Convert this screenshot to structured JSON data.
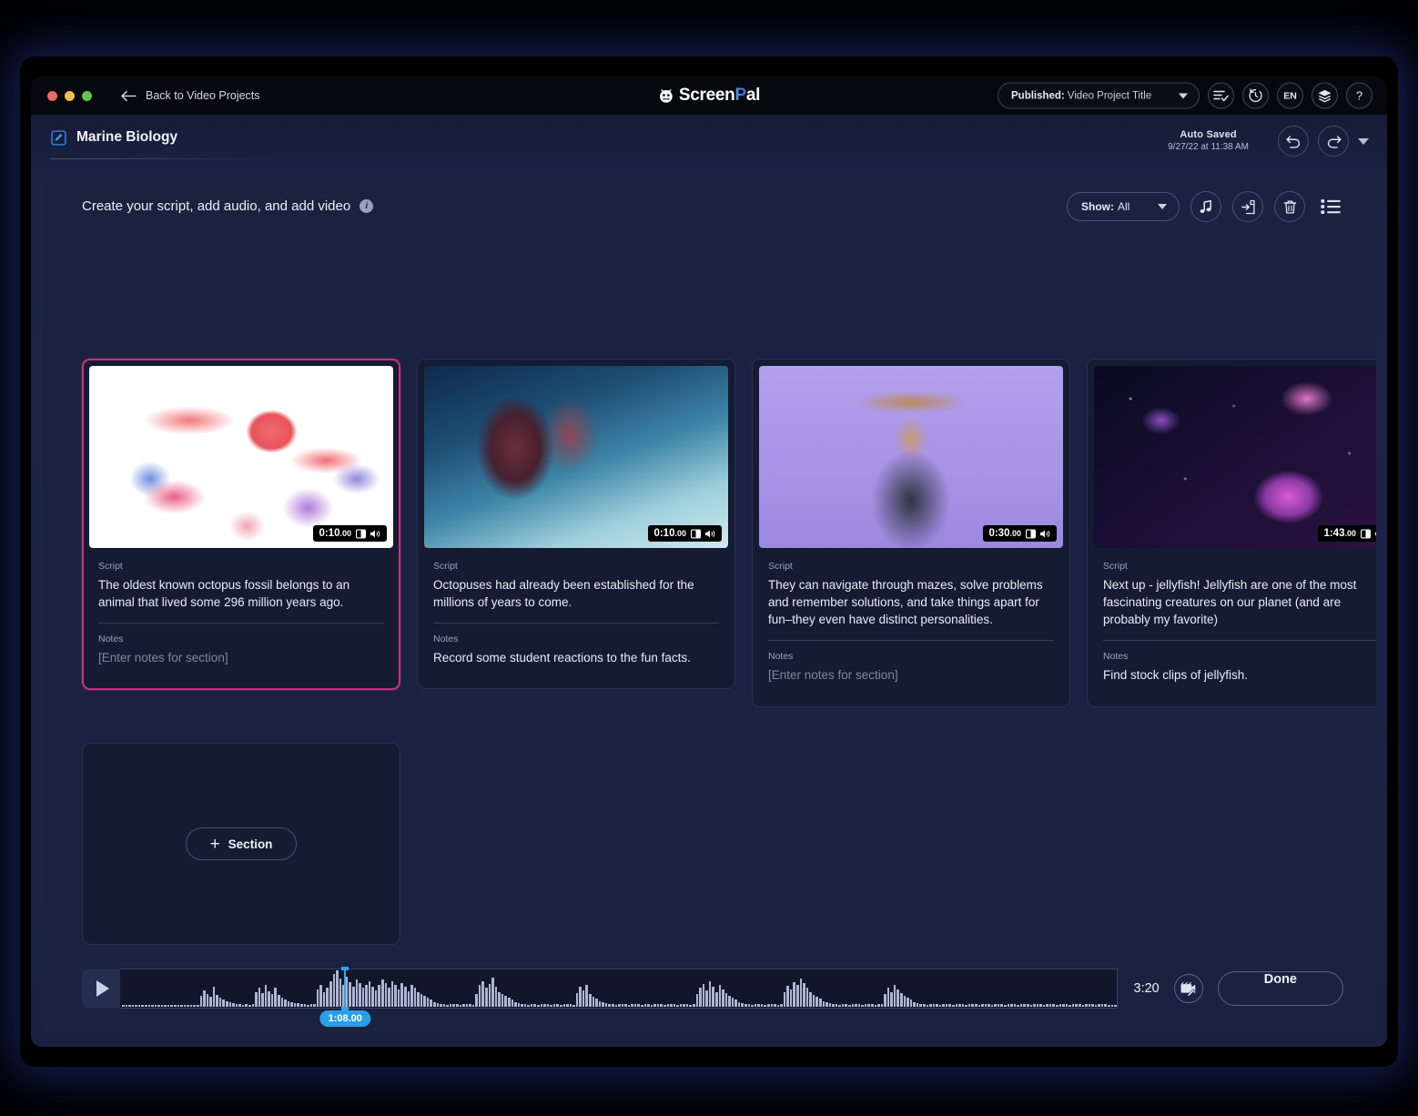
{
  "window": {
    "back_label": "Back to Video Projects",
    "brand": {
      "part1": "Screen",
      "part2": "P",
      "part3": "al",
      "full": "ScreenPal"
    },
    "published_label": "Published:",
    "published_value": "Video Project Title",
    "lang": "EN",
    "help": "?",
    "icons": {
      "back_arrow": "arrow-left-icon",
      "logomark": "screenpal-logo-icon",
      "dropdown_caret": "chevron-down-icon",
      "checklist": "checklist-icon",
      "history": "history-clock-icon",
      "layers": "layers-icon",
      "help": "help-icon"
    }
  },
  "project": {
    "title": "Marine Biology",
    "edit_icon": "edit-square-icon",
    "autosave_label": "Auto Saved",
    "autosave_time": "9/27/22 at 11:38 AM",
    "undo_icon": "undo-icon",
    "redo_icon": "redo-icon"
  },
  "panel": {
    "heading": "Create your script, add audio, and add video",
    "info_icon": "info-icon",
    "show_label": "Show:",
    "show_value": "All",
    "music_icon": "music-note-icon",
    "import_icon": "import-icon",
    "trash_icon": "trash-icon",
    "list_icon": "list-view-icon"
  },
  "cards": [
    {
      "art": "art-octopus",
      "duration": "0:10",
      "frames": ".00",
      "selected": true,
      "script_label": "Script",
      "script": "The oldest known octopus fossil belongs to an animal that lived some 296 million years ago.",
      "notes_label": "Notes",
      "notes": "[Enter notes for section]",
      "notes_placeholder": true
    },
    {
      "art": "art-tentacle",
      "duration": "0:10",
      "frames": ".00",
      "selected": false,
      "script_label": "Script",
      "script": "Octopuses had already been established for the millions of years to come.",
      "notes_label": "Notes",
      "notes": "Record some student reactions to the fun facts.",
      "notes_placeholder": false
    },
    {
      "art": "art-person",
      "duration": "0:30",
      "frames": ".00",
      "selected": false,
      "script_label": "Script",
      "script": "They can navigate through mazes, solve problems and remember solutions, and take things apart for fun–they even have distinct personalities.",
      "notes_label": "Notes",
      "notes": "[Enter notes for section]",
      "notes_placeholder": true
    },
    {
      "art": "art-jelly",
      "duration": "1:43",
      "frames": ".00",
      "selected": false,
      "script_label": "Script",
      "script": "Next up - jellyfish! Jellyfish are one of the most fascinating creatures on our planet (and are probably my favorite)",
      "notes_label": "Notes",
      "notes": "Find stock clips of jellyfish.",
      "notes_placeholder": false
    }
  ],
  "add_section": {
    "label": "Section",
    "plus": "+"
  },
  "timeline": {
    "play_icon": "play-icon",
    "playhead_time": "1:08.00",
    "playhead_pct": 22.5,
    "total_time": "3:20",
    "edit_video_icon": "edit-video-icon",
    "done_label": "Done",
    "waveform": [
      2,
      2,
      3,
      2,
      4,
      3,
      2,
      3,
      2,
      3,
      2,
      4,
      3,
      2,
      3,
      2,
      3,
      2,
      4,
      3,
      2,
      3,
      4,
      3,
      22,
      34,
      26,
      20,
      40,
      24,
      18,
      14,
      12,
      10,
      8,
      6,
      5,
      4,
      5,
      4,
      5,
      30,
      38,
      28,
      44,
      32,
      26,
      38,
      24,
      18,
      14,
      12,
      10,
      8,
      7,
      6,
      5,
      4,
      5,
      6,
      36,
      44,
      30,
      38,
      52,
      66,
      74,
      58,
      44,
      62,
      50,
      40,
      56,
      48,
      38,
      44,
      52,
      40,
      34,
      44,
      56,
      48,
      38,
      52,
      44,
      36,
      48,
      40,
      32,
      44,
      38,
      30,
      26,
      22,
      18,
      14,
      10,
      8,
      6,
      5,
      4,
      5,
      6,
      5,
      4,
      5,
      6,
      5,
      4,
      26,
      44,
      52,
      38,
      46,
      60,
      40,
      30,
      26,
      22,
      18,
      14,
      10,
      8,
      6,
      5,
      4,
      6,
      5,
      4,
      5,
      6,
      5,
      4,
      6,
      5,
      4,
      5,
      6,
      5,
      4,
      28,
      40,
      34,
      44,
      26,
      20,
      16,
      12,
      10,
      8,
      6,
      5,
      4,
      5,
      6,
      5,
      4,
      5,
      6,
      5,
      4,
      6,
      5,
      4,
      5,
      6,
      5,
      4,
      5,
      6,
      5,
      4,
      5,
      6,
      5,
      4,
      5,
      26,
      38,
      46,
      34,
      52,
      40,
      30,
      44,
      36,
      28,
      22,
      18,
      14,
      10,
      8,
      6,
      5,
      4,
      5,
      6,
      5,
      4,
      5,
      6,
      5,
      4,
      5,
      30,
      42,
      36,
      50,
      44,
      58,
      48,
      38,
      30,
      24,
      20,
      16,
      12,
      10,
      8,
      6,
      5,
      4,
      6,
      5,
      4,
      5,
      6,
      5,
      4,
      5,
      6,
      5,
      4,
      5,
      6,
      26,
      38,
      30,
      44,
      36,
      28,
      22,
      18,
      14,
      10,
      8,
      6,
      5,
      4,
      5,
      6,
      5,
      4,
      5,
      6,
      5,
      4,
      5,
      6,
      5,
      4,
      5,
      6,
      5,
      4,
      5,
      6,
      5,
      4,
      5,
      6,
      5,
      4,
      5,
      6,
      5,
      4,
      5,
      6,
      5,
      4,
      5,
      6,
      5,
      4,
      5,
      6,
      5,
      4,
      5,
      6,
      5,
      4,
      5,
      6,
      5,
      4,
      5,
      6,
      5,
      4,
      5,
      6,
      5,
      4,
      3,
      2
    ]
  },
  "colors": {
    "selected_border": "#c2337c",
    "accent_blue": "#2b9fe6",
    "panel_bg": "#1b2240",
    "card_bg": "#151b33"
  }
}
